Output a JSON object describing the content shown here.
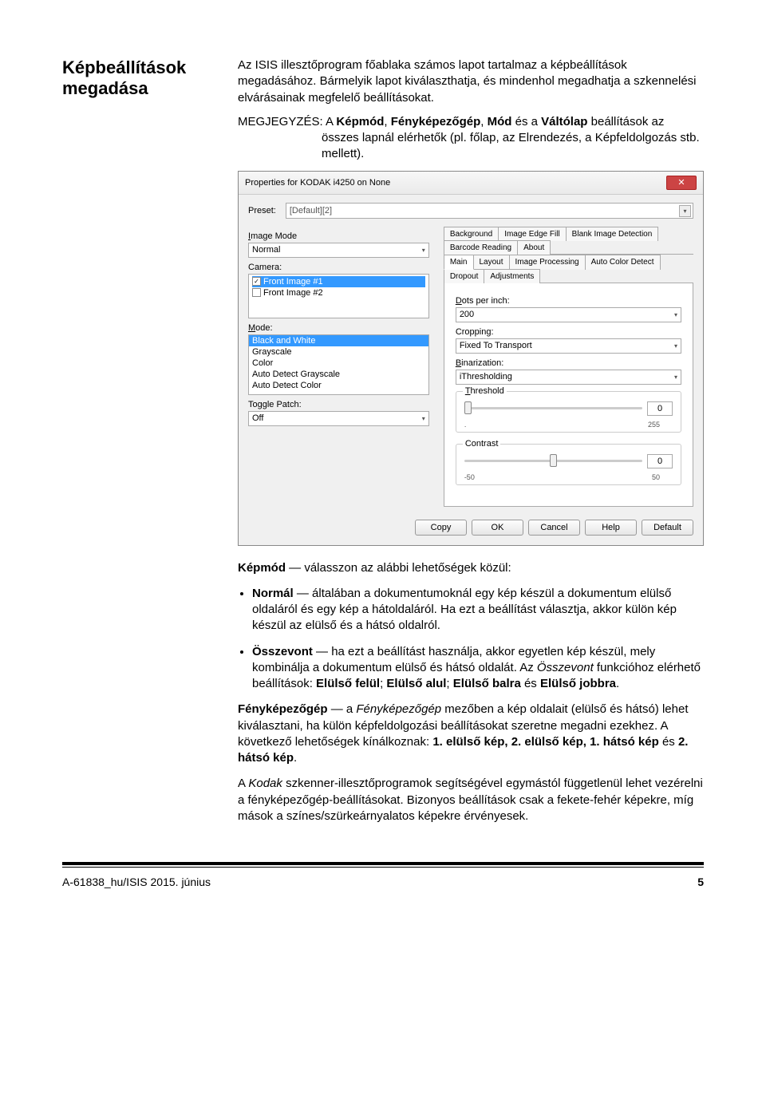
{
  "heading": "Képbeállítások megadása",
  "intro_para": "Az ISIS illesztőprogram főablaka számos lapot tartalmaz a képbeállítások megadásához. Bármelyik lapot kiválaszthatja, és mindenhol megadhatja a szkennelési elvárásainak megfelelő beállításokat.",
  "note_label": "MEGJEGYZÉS: ",
  "note_body_pre": "A ",
  "note_w1": "Képmód",
  "note_sep1": ", ",
  "note_w2": "Fényképezőgép",
  "note_sep2": ", ",
  "note_w3": "Mód",
  "note_sep3": " és a ",
  "note_w4": "Váltólap",
  "note_body_post": " beállítások az összes lapnál elérhetők (pl. főlap, az Elrendezés, a Képfeldolgozás stb. mellett).",
  "ss": {
    "title": "Properties for KODAK i4250 on None",
    "preset_label": "Preset:",
    "preset_value": "[Default][2]",
    "image_mode_label": "Image Mode",
    "image_mode_value": "Normal",
    "camera_label": "Camera:",
    "cam1": "Front Image #1",
    "cam2": "Front Image #2",
    "mode_label": "Mode:",
    "mode1": "Black and White",
    "mode2": "Grayscale",
    "mode3": "Color",
    "mode4": "Auto Detect Grayscale",
    "mode5": "Auto Detect Color",
    "toggle_label": "Toggle Patch:",
    "toggle_value": "Off",
    "tabs_row1": [
      "Background",
      "Image Edge Fill",
      "Blank Image Detection",
      "Barcode Reading",
      "About"
    ],
    "tabs_row2": [
      "Main",
      "Layout",
      "Image Processing",
      "Auto Color Detect",
      "Dropout",
      "Adjustments"
    ],
    "dpi_label": "Dots per inch:",
    "dpi_value": "200",
    "cropping_label": "Cropping:",
    "cropping_value": "Fixed To Transport",
    "bin_label": "Binarization:",
    "bin_value": "iThresholding",
    "threshold_label": "Threshold",
    "threshold_value": "0",
    "threshold_min": ".",
    "threshold_max": "255",
    "contrast_label": "Contrast",
    "contrast_value": "0",
    "contrast_min": "-50",
    "contrast_max": "50",
    "btn_copy": "Copy",
    "btn_ok": "OK",
    "btn_cancel": "Cancel",
    "btn_help": "Help",
    "btn_default": "Default"
  },
  "kepmod_lead_b": "Képmód",
  "kepmod_lead_t": " — válasszon az alábbi lehetőségek közül:",
  "b1_bold": "Normál",
  "b1_text": " — általában a dokumentumoknál egy kép készül a dokumentum elülső oldaláról és egy kép a hátoldaláról. Ha ezt a beállítást választja, akkor külön kép készül az elülső és a hátsó oldalról.",
  "b2_bold": "Összevont",
  "b2_text1": " — ha ezt a beállítást használja, akkor egyetlen kép készül, mely kombinálja a dokumentum elülső és hátsó oldalát. Az ",
  "b2_it": "Összevont",
  "b2_text2": " funkcióhoz elérhető beállítások: ",
  "b2_o1": "Elülső felül",
  "b2_o2": "Elülső alul",
  "b2_o3": "Elülső balra",
  "b2_o4": "Elülső jobbra",
  "b2_and": " és ",
  "fgep_b": "Fényképezőgép",
  "fgep_d": " — a ",
  "fgep_it": "Fényképezőgép",
  "fgep_t1": " mezőben a kép oldalait (elülső és hátsó) lehet kiválasztani, ha külön képfeldolgozási beállításokat szeretne megadni ezekhez. A következő lehetőségek kínálkoznak: ",
  "fgep_o1": "1. elülső kép, 2. elülső kép, 1. hátsó kép",
  "fgep_and": " és ",
  "fgep_o2": "2. hátsó kép",
  "kodak_pre": "A ",
  "kodak_it": "Kodak",
  "kodak_t": " szkenner-illesztőprogramok segítségével egymástól függetlenül lehet vezérelni a fényképezőgép-beállításokat. Bizonyos beállítások csak a fekete-fehér képekre, míg mások a színes/szürkeárnyalatos képekre érvényesek.",
  "footer_left": "A-61838_hu/ISIS  2015. június",
  "footer_right": "5"
}
